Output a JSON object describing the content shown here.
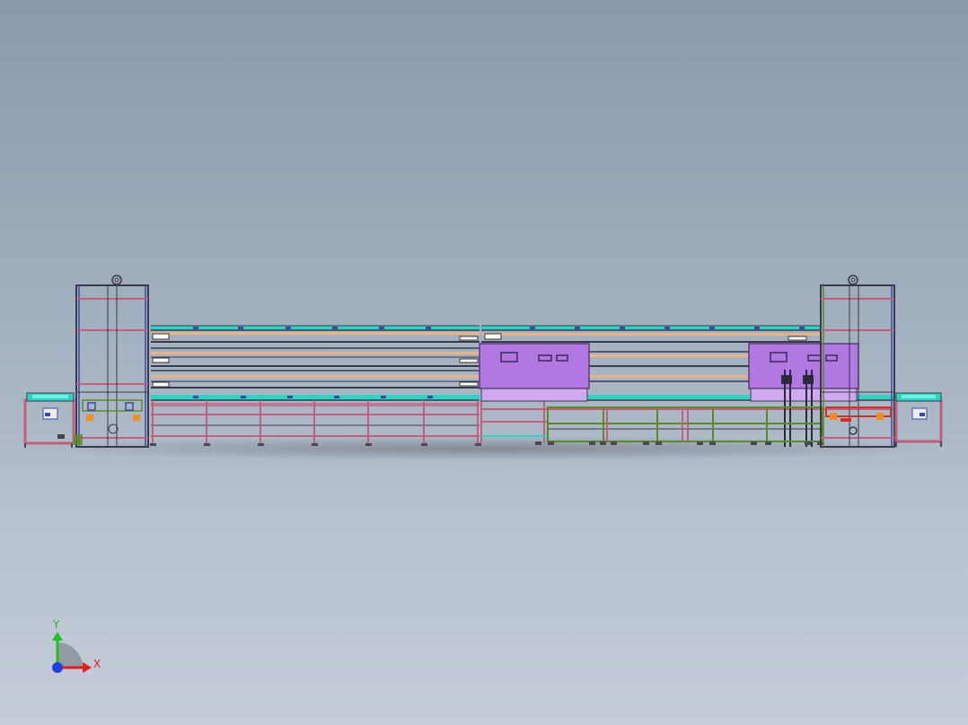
{
  "view": {
    "background_top": "#8a9aac",
    "background_bottom": "#c4cdd8"
  },
  "model": {
    "colors": {
      "frame_pink": "#c0607e",
      "frame_dark": "#3a3a4a",
      "conveyor_cyan": "#2fd3c4",
      "belt_orange": "#e9b38a",
      "cabinet_purple": "#b078e0",
      "cabinet_edge": "#5a3a7a",
      "frame_green": "#5a8a2a",
      "frame_blue": "#3a48a8",
      "frame_red": "#d0302a",
      "motor_orange": "#f09020",
      "foot_gray": "#4a4a52"
    }
  },
  "triad": {
    "x_label": "X",
    "y_label": "Y",
    "x_color": "#e02020",
    "y_color": "#20c020",
    "z_color": "#2040e0"
  }
}
